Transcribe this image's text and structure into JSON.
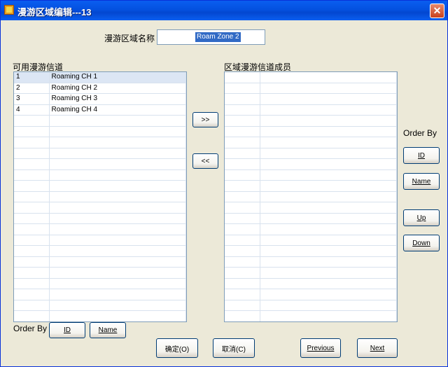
{
  "window": {
    "title": "漫游区域编辑---13",
    "close_glyph": "✕"
  },
  "zone_name": {
    "label": "漫游区域名称",
    "value": "Roam Zone 2"
  },
  "available": {
    "label": "可用漫游信道",
    "rows": [
      {
        "id": "1",
        "name": "Roaming CH 1"
      },
      {
        "id": "2",
        "name": "Roaming CH 2"
      },
      {
        "id": "3",
        "name": "Roaming CH 3"
      },
      {
        "id": "4",
        "name": "Roaming CH 4"
      }
    ]
  },
  "members": {
    "label": "区域漫游信道成员"
  },
  "transfer": {
    "add_label": ">>",
    "remove_label": "<<"
  },
  "left_order": {
    "label": "Order By",
    "id_label": "ID",
    "name_label": "Name"
  },
  "right_order": {
    "label": "Order By",
    "id_label": "ID",
    "name_label": "Name",
    "up_label": "Up",
    "down_label": "Down"
  },
  "footer": {
    "ok_label": "确定(O)",
    "cancel_label": "取消(C)",
    "previous_label": "Previous",
    "next_label": "Next"
  },
  "colors": {
    "titlebar": "#0451e0",
    "selection": "#316ac5",
    "face": "#ece9d8"
  }
}
